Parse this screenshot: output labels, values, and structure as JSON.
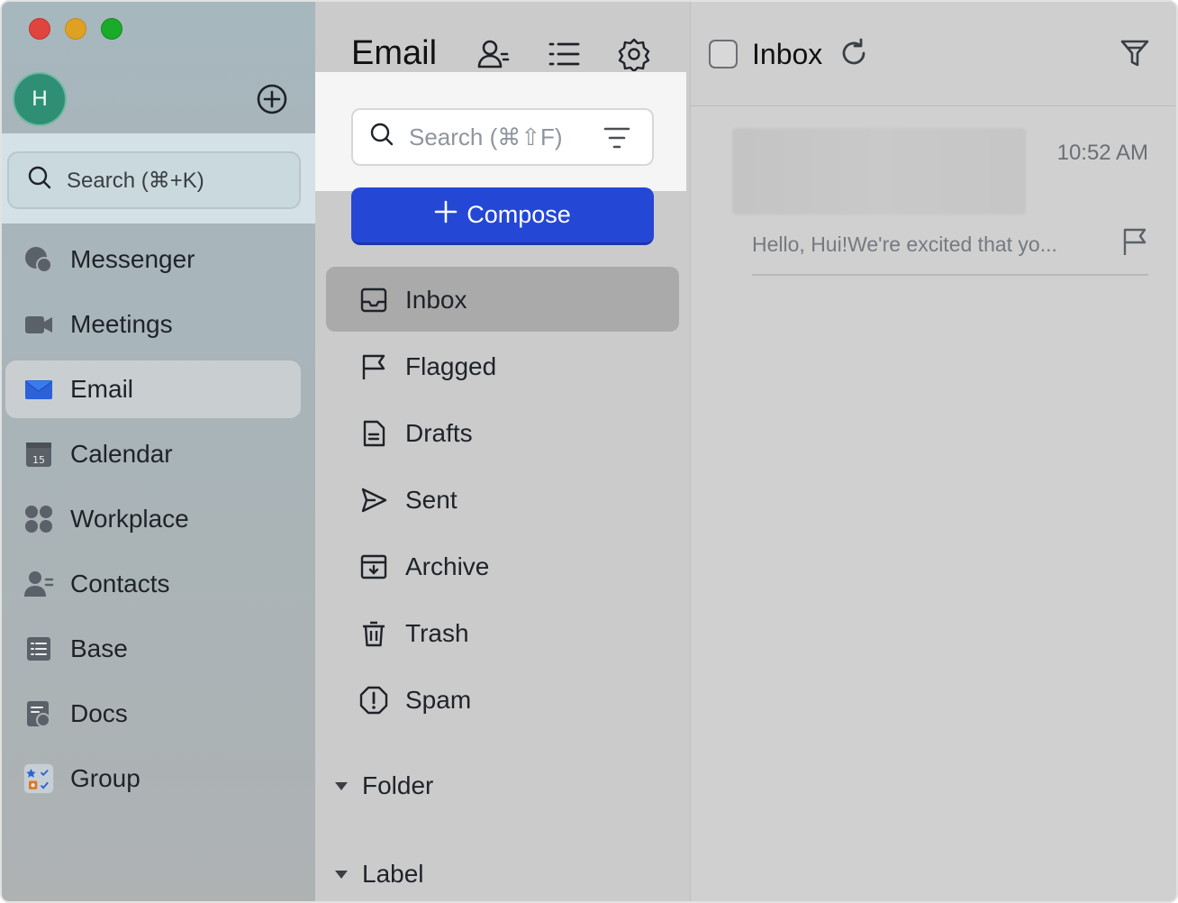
{
  "sidebar": {
    "avatar_initial": "H",
    "search_label": "Search (⌘+K)",
    "items": [
      {
        "label": "Messenger",
        "icon": "messenger-icon"
      },
      {
        "label": "Meetings",
        "icon": "video-camera-icon"
      },
      {
        "label": "Email",
        "icon": "envelope-icon",
        "active": true
      },
      {
        "label": "Calendar",
        "icon": "calendar-icon",
        "badge": "15"
      },
      {
        "label": "Workplace",
        "icon": "apps-grid-icon"
      },
      {
        "label": "Contacts",
        "icon": "contacts-icon"
      },
      {
        "label": "Base",
        "icon": "base-icon"
      },
      {
        "label": "Docs",
        "icon": "docs-icon"
      },
      {
        "label": "Group",
        "icon": "group-icon"
      }
    ]
  },
  "email_panel": {
    "title": "Email",
    "search_placeholder": "Search (⌘⇧F)",
    "compose_label": "Compose",
    "folders": [
      {
        "label": "Inbox",
        "icon": "inbox-icon",
        "active": true
      },
      {
        "label": "Flagged",
        "icon": "flag-icon"
      },
      {
        "label": "Drafts",
        "icon": "draft-icon"
      },
      {
        "label": "Sent",
        "icon": "send-icon"
      },
      {
        "label": "Archive",
        "icon": "archive-icon"
      },
      {
        "label": "Trash",
        "icon": "trash-icon"
      },
      {
        "label": "Spam",
        "icon": "spam-icon"
      }
    ],
    "sections": {
      "folder": "Folder",
      "label": "Label"
    }
  },
  "inbox": {
    "title": "Inbox",
    "messages": [
      {
        "time": "10:52 AM",
        "preview": "Hello, Hui!We're excited that yo..."
      }
    ]
  },
  "colors": {
    "accent": "#2447d6",
    "avatar": "#2f8f74"
  }
}
